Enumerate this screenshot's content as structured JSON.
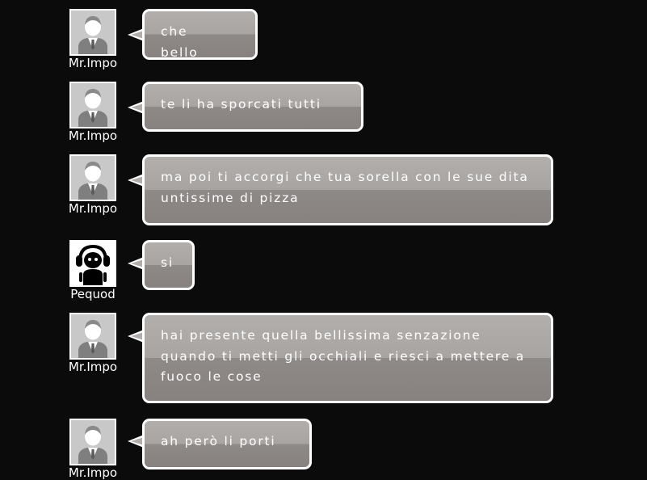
{
  "messages": [
    {
      "user": "Mr.Impo",
      "avatar": "suit-man-avatar",
      "text": "che bello"
    },
    {
      "user": "Mr.Impo",
      "avatar": "suit-man-avatar",
      "text": "te li ha sporcati tutti"
    },
    {
      "user": "Mr.Impo",
      "avatar": "suit-man-avatar",
      "text": "ma poi ti accorgi che tua sorella con le sue dita untissime di pizza"
    },
    {
      "user": "Pequod",
      "avatar": "headphones-avatar",
      "text": "si"
    },
    {
      "user": "Mr.Impo",
      "avatar": "suit-man-avatar",
      "text": "hai presente quella bellissima senzazione quando ti metti gli occhiali e riesci a mettere a fuoco le cose"
    },
    {
      "user": "Mr.Impo",
      "avatar": "suit-man-avatar",
      "text": "ah però li porti"
    }
  ],
  "colors": {
    "background": "#0b0b0b",
    "bubble_top": "#b1aeac",
    "bubble_bottom": "#87817f",
    "border": "#ffffff",
    "text": "#ffffff"
  }
}
